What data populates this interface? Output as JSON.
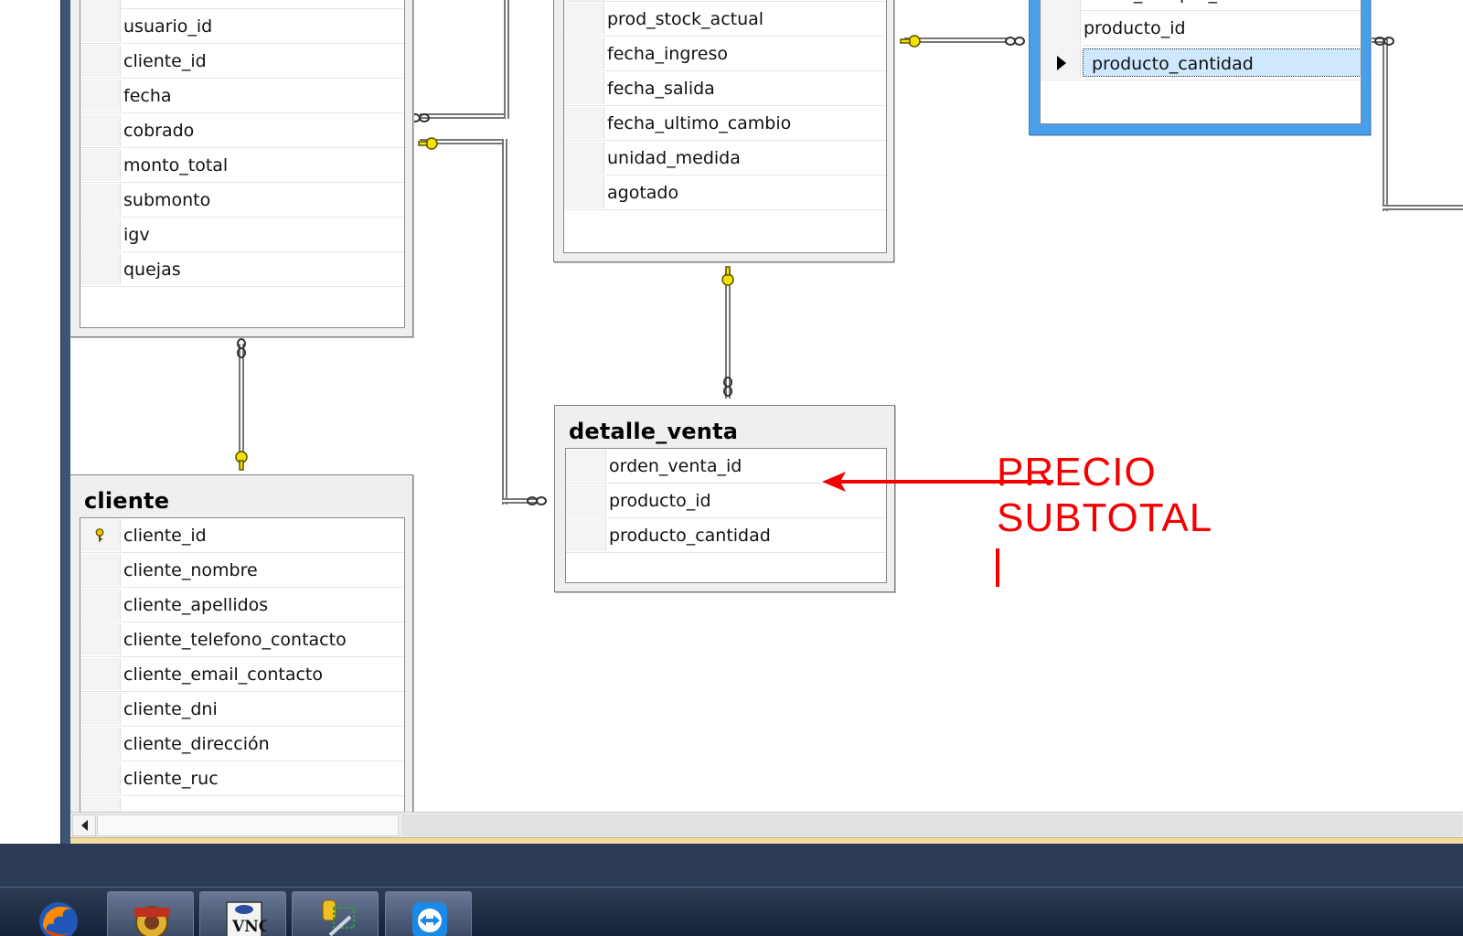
{
  "diagram": {
    "tables": [
      {
        "id": "orden_venta",
        "title": "",
        "columns": [
          {
            "name": "usuario_id"
          },
          {
            "name": "cliente_id"
          },
          {
            "name": "fecha"
          },
          {
            "name": "cobrado"
          },
          {
            "name": "monto_total"
          },
          {
            "name": "submonto"
          },
          {
            "name": "igv"
          },
          {
            "name": "quejas"
          }
        ]
      },
      {
        "id": "producto",
        "title": "",
        "columns": [
          {
            "name": "prod_stock_actual"
          },
          {
            "name": "fecha_ingreso"
          },
          {
            "name": "fecha_salida"
          },
          {
            "name": "fecha_ultimo_cambio"
          },
          {
            "name": "unidad_medida"
          },
          {
            "name": "agotado"
          }
        ]
      },
      {
        "id": "detalle_compra",
        "title": "",
        "columns": [
          {
            "name": "orden_compra_id"
          },
          {
            "name": "producto_id"
          },
          {
            "name": "producto_cantidad",
            "current": true
          }
        ]
      },
      {
        "id": "detalle_venta",
        "title": "detalle_venta",
        "columns": [
          {
            "name": "orden_venta_id"
          },
          {
            "name": "producto_id"
          },
          {
            "name": "producto_cantidad"
          }
        ]
      },
      {
        "id": "cliente",
        "title": "cliente",
        "columns": [
          {
            "name": "cliente_id",
            "primary_key": true
          },
          {
            "name": "cliente_nombre"
          },
          {
            "name": "cliente_apellidos"
          },
          {
            "name": "cliente_telefono_contacto"
          },
          {
            "name": "cliente_email_contacto"
          },
          {
            "name": "cliente_dni"
          },
          {
            "name": "cliente_dirección"
          },
          {
            "name": "cliente_ruc"
          }
        ]
      }
    ],
    "annotation": {
      "lines": [
        "PRECIO",
        "SUBTOTAL"
      ],
      "color": "#f40000"
    }
  },
  "taskbar": {
    "apps": [
      {
        "name": "firefox-icon"
      },
      {
        "name": "java-ee-ide-icon"
      },
      {
        "name": "vnc-icon"
      },
      {
        "name": "sql-server-management-icon"
      },
      {
        "name": "teamviewer-icon"
      }
    ]
  },
  "colors": {
    "selected_table": "#4a9fe9",
    "window_frame": "#3d5378",
    "taskbar": "#1e2a42"
  }
}
